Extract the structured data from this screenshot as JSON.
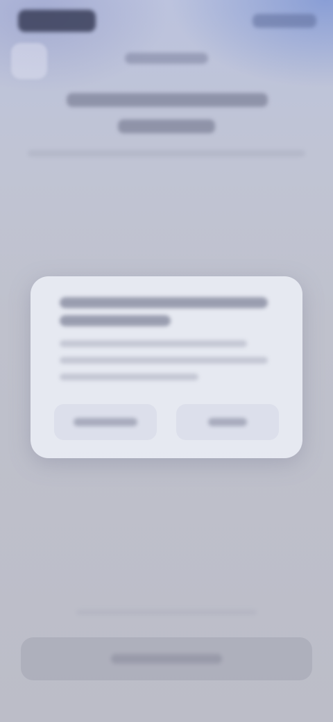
{
  "header": {
    "label": "",
    "title": "",
    "subtitle": ""
  },
  "dialog": {
    "title": "",
    "message": "",
    "secondary_button_label": "",
    "primary_button_label": ""
  },
  "footer": {
    "note": "",
    "button_label": ""
  }
}
